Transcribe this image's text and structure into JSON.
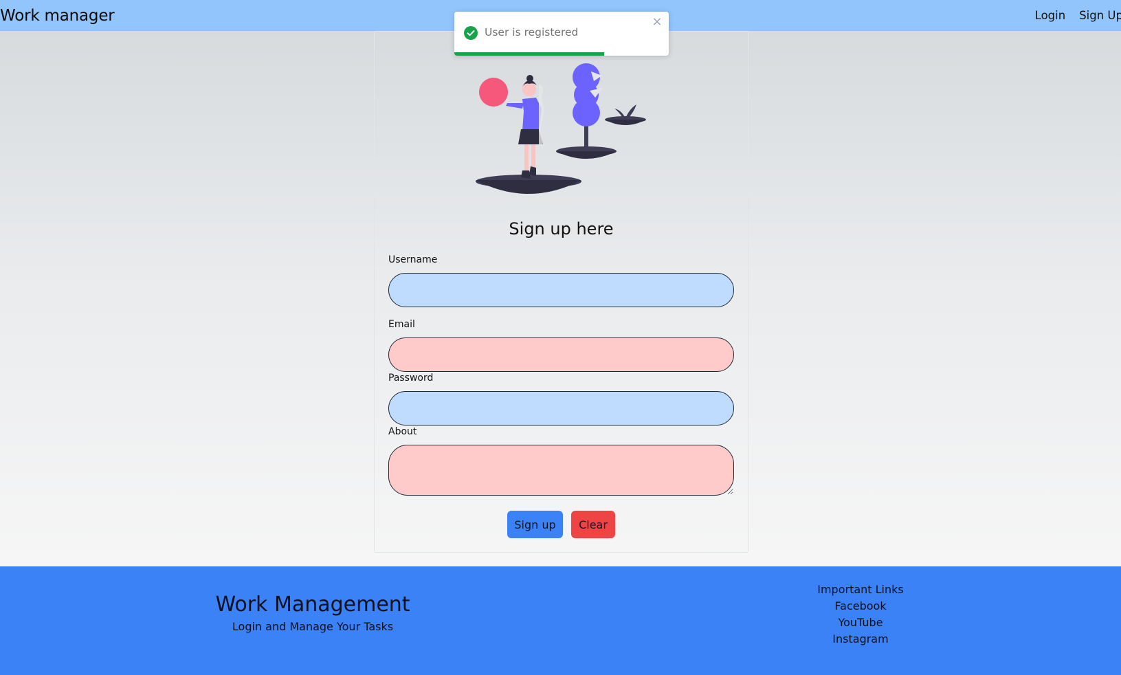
{
  "navbar": {
    "brand": "Work manager",
    "links": [
      "Login",
      "Sign Up"
    ]
  },
  "form": {
    "title": "Sign up here",
    "fields": {
      "username": {
        "label": "Username",
        "value": ""
      },
      "email": {
        "label": "Email",
        "value": ""
      },
      "password": {
        "label": "Password",
        "value": ""
      },
      "about": {
        "label": "About",
        "value": ""
      }
    },
    "buttons": {
      "signup": "Sign up",
      "clear": "Clear"
    }
  },
  "toast": {
    "message": "User is registered",
    "progress_fraction": 0.7,
    "icon": "check-circle-icon",
    "close_glyph": "×",
    "color": "#16a34a"
  },
  "footer": {
    "title": "Work Management",
    "subtitle": "Login and Manage Your Tasks",
    "links_heading": "Important Links",
    "links": [
      "Facebook",
      "YouTube",
      "Instagram"
    ]
  },
  "colors": {
    "navbar": "#93c5fd",
    "footer": "#3b82f6",
    "signup_button": "#3b82f6",
    "clear_button": "#ef4444",
    "field_blue": "#bfdbfe",
    "field_pink": "#fecaca"
  }
}
